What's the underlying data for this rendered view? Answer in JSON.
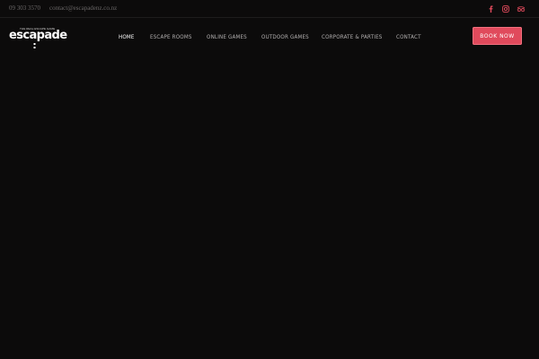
{
  "topbar": {
    "phone": "09 303 3570",
    "email": "contact@escapadenz.co.nz",
    "social_icons": [
      "facebook-icon",
      "instagram-icon",
      "tripadvisor-icon"
    ],
    "social_color": "#e04a5c"
  },
  "logo": {
    "tagline": "THE REAL ESCAPE GAME",
    "wordmark": "escapade"
  },
  "nav": {
    "items": [
      {
        "label": "HOME",
        "active": true
      },
      {
        "label": "ESCAPE ROOMS",
        "active": false
      },
      {
        "label": "ONLINE GAMES",
        "active": false
      },
      {
        "label": "OUTDOOR GAMES",
        "active": false
      },
      {
        "label": "CORPORATE & PARTIES",
        "active": false
      },
      {
        "label": "CONTACT",
        "active": false
      }
    ],
    "active_underline_color": "#e04a5c"
  },
  "book_button": {
    "label": "BOOK NOW",
    "color": "#e04a5c"
  },
  "colors": {
    "background": "#0c0b0b",
    "accent": "#e04a5c"
  }
}
